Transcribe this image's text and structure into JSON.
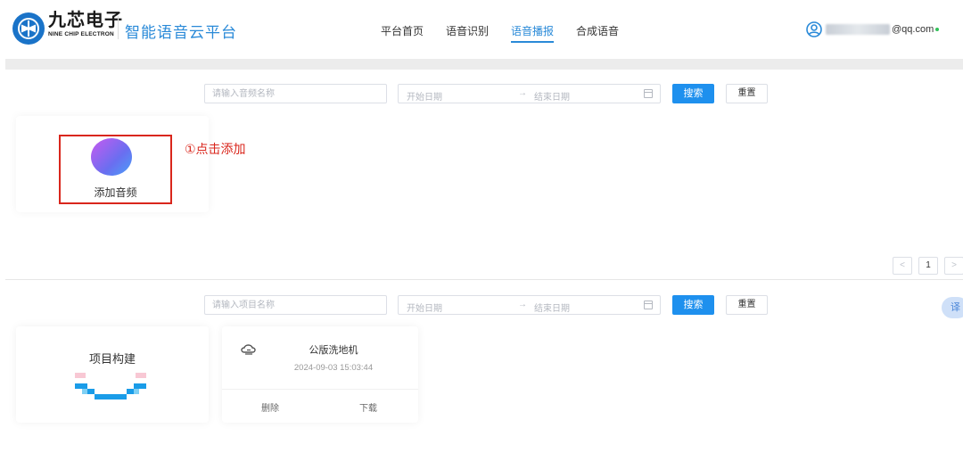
{
  "header": {
    "brand_cn": "九芯电子",
    "brand_en": "NINE CHIP ELECTRON",
    "platform_title": "智能语音云平台",
    "nav": [
      {
        "label": "平台首页",
        "active": false
      },
      {
        "label": "语音识别",
        "active": false
      },
      {
        "label": "语音播报",
        "active": true
      },
      {
        "label": "合成语音",
        "active": false
      }
    ],
    "user_email_suffix": "@qq.com"
  },
  "audio_search": {
    "name_placeholder": "请输入音频名称",
    "start_placeholder": "开始日期",
    "range_arrow": "→",
    "end_placeholder": "结束日期",
    "search_label": "搜索",
    "reset_label": "重置"
  },
  "add_audio": {
    "label": "添加音频",
    "annotation": "①点击添加"
  },
  "pagination": {
    "prev": "<",
    "current": "1",
    "next": ">"
  },
  "project_search": {
    "name_placeholder": "请输入项目名称",
    "start_placeholder": "开始日期",
    "range_arrow": "→",
    "end_placeholder": "结束日期",
    "search_label": "搜索",
    "reset_label": "重置"
  },
  "project_build": {
    "title": "项目构建"
  },
  "project_item": {
    "name": "公版洗地机",
    "date": "2024-09-03 15:03:44",
    "delete_label": "删除",
    "download_label": "下载"
  },
  "float_button": {
    "label": "译"
  },
  "colors": {
    "accent": "#1e90ee",
    "annotation_red": "#d9261c"
  }
}
